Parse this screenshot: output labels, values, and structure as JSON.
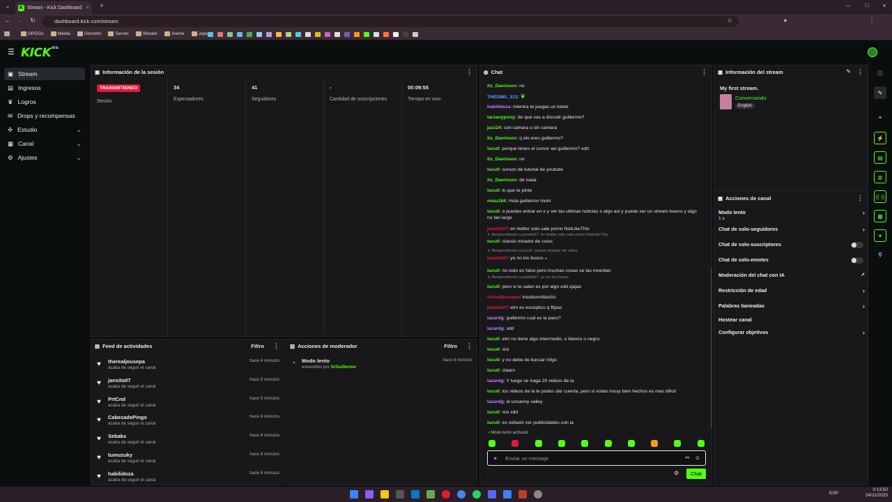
{
  "browser": {
    "tab_title": "Stream - Kick Dashboard",
    "url": "dashboard.kick.com/stream",
    "bookmarks": [
      "OPGGs",
      "Media",
      "Genshin",
      "Server",
      "Stream",
      "Anime",
      "Japo"
    ]
  },
  "app": {
    "logo": "KICK",
    "logo_badge": "BETA"
  },
  "sidebar": {
    "items": [
      {
        "label": "Stream",
        "icon": "video-icon"
      },
      {
        "label": "Ingresos",
        "icon": "money-icon"
      },
      {
        "label": "Logros",
        "icon": "trophy-icon"
      },
      {
        "label": "Drops y recompensas",
        "icon": "gift-icon"
      },
      {
        "label": "Estudio",
        "icon": "studio-icon"
      },
      {
        "label": "Canal",
        "icon": "channel-icon"
      },
      {
        "label": "Ajustes",
        "icon": "gear-icon"
      }
    ]
  },
  "session": {
    "title": "Información de la sesión",
    "live_badge": "TRANSMITIENDO",
    "session_label": "Sesión",
    "stats": [
      {
        "value": "34",
        "label": "Espectadores"
      },
      {
        "value": "41",
        "label": "Seguidores"
      },
      {
        "value": "-",
        "label": "Cantidad de suscripciones"
      },
      {
        "value": "00:09:55",
        "label": "Tiempo en vivo"
      }
    ]
  },
  "feed": {
    "title": "Feed de actividades",
    "filter": "Filtro",
    "items": [
      {
        "name": "therealjousepa",
        "sub": "acaba de seguir el canal",
        "time": "hace 4 minutos"
      },
      {
        "name": "jansito07",
        "sub": "acaba de seguir el canal",
        "time": "hace 5 minutos"
      },
      {
        "name": "PrtCnd",
        "sub": "acaba de seguir el canal",
        "time": "hace 5 minutos"
      },
      {
        "name": "CabezadePingo",
        "sub": "acaba de seguir el canal",
        "time": "hace 6 minutos"
      },
      {
        "name": "Sebakx",
        "sub": "acaba de seguir el canal",
        "time": "hace 8 minutos"
      },
      {
        "name": "tumuzuky",
        "sub": "acaba de seguir el canal",
        "time": "hace 8 minutos"
      },
      {
        "name": "habilidoza",
        "sub": "acaba de seguir el canal",
        "time": "hace 8 minutos"
      }
    ]
  },
  "mod": {
    "title": "Acciones de moderador",
    "filter": "Filtro",
    "item_title": "Modo lento",
    "item_sub": "encendido por",
    "item_user": "SrGuillermo",
    "item_time": "hace 8 minutos"
  },
  "chat": {
    "title": "Chat",
    "messages": [
      {
        "user": "its_Davinson",
        "text": "no",
        "color": "#53fc18"
      },
      {
        "user": "THEDMX_313",
        "text": "",
        "color": "#5b9cff"
      },
      {
        "user": "habilidoza",
        "text": "mientra te juegas un lolete",
        "color": "#c580ff"
      },
      {
        "user": "tarzanypony",
        "text": "de que vas a discutir guillermo?",
        "color": "#53fc18"
      },
      {
        "user": "jazz24",
        "text": "con camara o sin camara",
        "color": "#53fc18"
      },
      {
        "user": "its_Davinson",
        "text": "q elo eres guillermo?",
        "color": "#53fc18"
      },
      {
        "user": "lucu0",
        "text": "porque tenes el cursor asi guillermo? xdd",
        "color": "#53fc18"
      },
      {
        "user": "its_Davinson",
        "text": "no",
        "color": "#53fc18"
      },
      {
        "user": "lucu0",
        "text": "curson de tutorial de youtube",
        "color": "#53fc18"
      },
      {
        "user": "its_Davinson",
        "text": "de nada",
        "color": "#53fc18"
      },
      {
        "user": "lucu0",
        "text": "lo que te pinte",
        "color": "#53fc18"
      },
      {
        "user": "miau164",
        "text": "Hola guillermo mom",
        "color": "#53fc18"
      },
      {
        "user": "lucu0",
        "text": "o puedes entrar en x y ver las ultimas noticias o algo asi y puede ser un stream bueno y algo no tan largo",
        "color": "#53fc18"
      },
      {
        "user": "jansito07",
        "text": "en tiwtter solo sale porno NotLikeThis",
        "color": "#e0193b"
      },
      {
        "user": "lucu0",
        "text": "classic mirador de culos",
        "color": "#53fc18"
      },
      {
        "user": "jansito07",
        "text": "yo no los busco",
        "color": "#e0193b"
      },
      {
        "user": "lucu0",
        "text": "no todo es falso pero muchas cosas se las inventan",
        "color": "#53fc18"
      },
      {
        "user": "lucu0",
        "text": "pero si te salen es por algo xdd sjajas",
        "color": "#53fc18"
      },
      {
        "user": "thenotjeunepo",
        "text": "insubornidación.",
        "color": "#e0193b"
      },
      {
        "user": "jansito07",
        "text": "elm es esceptico q flipas",
        "color": "#e0193b"
      },
      {
        "user": "lazardg",
        "text": "guillermo cual es la pass?",
        "color": "#c580ff"
      },
      {
        "user": "lazardg",
        "text": "xdd",
        "color": "#c580ff"
      },
      {
        "user": "lucu0",
        "text": "elm no tiene algo intermedio, o blanco o negro",
        "color": "#53fc18"
      },
      {
        "user": "lucu0",
        "text": "sisi",
        "color": "#53fc18"
      },
      {
        "user": "lucu0",
        "text": "y no debe de buscar infgo",
        "color": "#53fc18"
      },
      {
        "user": "lucu0",
        "text": "claaro",
        "color": "#53fc18"
      },
      {
        "user": "lazardg",
        "text": "Y luego se traga 20 videos de ia",
        "color": "#c580ff"
      },
      {
        "user": "lucu0",
        "text": "los videos de la te podes dar cuenta, pero si estan muuy bien hechos es mas dificil",
        "color": "#53fc18"
      },
      {
        "user": "lazardg",
        "text": "el uncanny valley",
        "color": "#c580ff"
      },
      {
        "user": "lucu0",
        "text": "sisi xdd",
        "color": "#53fc18"
      },
      {
        "user": "lucu0",
        "text": "es nefasto ver publicidades con ia",
        "color": "#53fc18"
      }
    ],
    "replies": [
      "Respondiendo a jansito07: en tiwtter solo sale porno NotLikeThis",
      "Respondiendo a lucu0: classic mirador de culos",
      "Respondiendo a jansito07: yo no los busco"
    ],
    "slow_mode_notice": "Modo lento activado",
    "input_placeholder": "Enviar un mensaje",
    "send_label": "Chat"
  },
  "stream_info": {
    "title": "Información del stream",
    "stream_title": "My first stream.",
    "category": "Conversando",
    "language": "English"
  },
  "channel_actions": {
    "title": "Acciones de canal",
    "items": [
      {
        "label": "Modo lento",
        "sub": "1 s",
        "control": "arrow"
      },
      {
        "label": "Chat de solo-seguidores",
        "control": "arrow"
      },
      {
        "label": "Chat de solo-suscriptores",
        "control": "toggle"
      },
      {
        "label": "Chat de solo-emotes",
        "control": "toggle"
      },
      {
        "label": "Moderación del chat con IA",
        "control": "external"
      },
      {
        "label": "Restricción de edad",
        "control": "arrow"
      },
      {
        "label": "Palabras baneadas",
        "control": "arrow"
      },
      {
        "label": "Hostear canal",
        "control": "none"
      },
      {
        "label": "Configurar objetivos",
        "control": "arrow"
      }
    ]
  },
  "taskbar": {
    "lang": "ESP",
    "time": "0:13:50",
    "date": "24/11/2025"
  },
  "colors": {
    "accent": "#53fc18",
    "live": "#e0193b",
    "panel": "#18181b",
    "bg": "#0b0e0f"
  }
}
